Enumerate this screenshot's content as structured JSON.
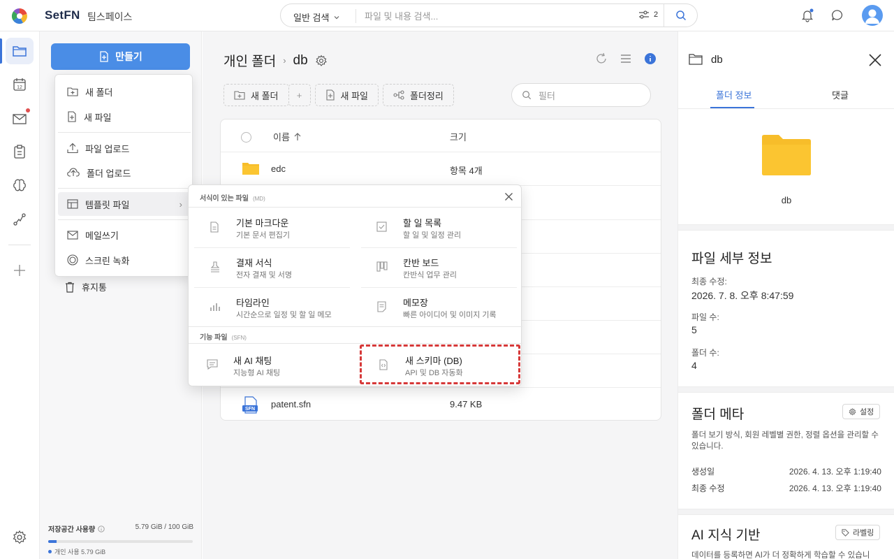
{
  "app": {
    "brand": "SetFN",
    "workspace": "팀스페이스"
  },
  "search": {
    "mode": "일반 검색",
    "placeholder": "파일 및 내용 검색...",
    "filter_count": "2"
  },
  "sidebar": {
    "create_label": "만들기",
    "trash_label": "휴지통",
    "storage_label": "저장공간 사용량",
    "storage_value": "5.79 GiB / 100 GiB",
    "storage_used_fraction": 0.058,
    "storage_personal": "개인 사용 5.79 GiB"
  },
  "create_menu": {
    "items": [
      {
        "label": "새 폴더",
        "icon": "folder-plus-icon"
      },
      {
        "label": "새 파일",
        "icon": "file-plus-icon"
      },
      {
        "label": "파일 업로드",
        "icon": "upload-icon"
      },
      {
        "label": "폴더 업로드",
        "icon": "cloud-upload-icon"
      },
      {
        "label": "템플릿 파일",
        "icon": "template-icon"
      },
      {
        "label": "메일쓰기",
        "icon": "mail-icon"
      },
      {
        "label": "스크린 녹화",
        "icon": "record-icon"
      }
    ]
  },
  "template_menu": {
    "section1_title": "서식이 있는 파일",
    "section1_tag": "(MD)",
    "section2_title": "기능 파일",
    "section2_tag": "(SFN)",
    "items": [
      {
        "title": "기본 마크다운",
        "desc": "기본 문서 편집기",
        "icon": "document-icon"
      },
      {
        "title": "할 일 목록",
        "desc": "할 일 및 일정 관리",
        "icon": "checkbox-icon"
      },
      {
        "title": "결재 서식",
        "desc": "전자 결재 및 서명",
        "icon": "stamp-icon"
      },
      {
        "title": "칸반 보드",
        "desc": "칸반식 업무 관리",
        "icon": "kanban-icon"
      },
      {
        "title": "타임라인",
        "desc": "시간순으로 일정 및 할 일 메모",
        "icon": "bar-chart-icon"
      },
      {
        "title": "메모장",
        "desc": "빠른 아이디어 및 이미지 기록",
        "icon": "memo-icon"
      },
      {
        "title": "새 AI 채팅",
        "desc": "지능형 AI 채팅",
        "icon": "chat-icon"
      },
      {
        "title": "새 스키마 (DB)",
        "desc": "API 및 DB 자동화",
        "icon": "code-file-icon"
      }
    ]
  },
  "main": {
    "breadcrumb_parent": "개인 폴더",
    "breadcrumb_current": "db",
    "toolbar": {
      "new_folder": "새 폴더",
      "plus": "+",
      "new_file": "새 파일",
      "organize": "폴더정리",
      "filter_placeholder": "필터"
    },
    "table": {
      "col_name": "이름",
      "col_size": "크기",
      "rows": [
        {
          "name": "edc",
          "size": "항목 4개",
          "type": "folder"
        },
        {
          "name": "patent.sfn",
          "size": "9.47 KB",
          "type": "sfn"
        }
      ]
    }
  },
  "details": {
    "folder_name": "db",
    "tab_info": "폴더 정보",
    "tab_comments": "댓글",
    "section_file_details": "파일 세부 정보",
    "last_modified_label": "최종 수정:",
    "last_modified_value": "2026. 7. 8. 오후 8:47:59",
    "file_count_label": "파일 수:",
    "file_count_value": "5",
    "folder_count_label": "폴더 수:",
    "folder_count_value": "4",
    "section_meta": "폴더 메타",
    "settings_button": "설정",
    "meta_desc": "폴더 보기 방식, 회원 레벨별 권한, 정렬 옵션을 관리할 수 있습니다.",
    "created_label": "생성일",
    "created_value": "2026. 4. 13. 오후 1:19:40",
    "modified_label": "최종 수정",
    "modified_value": "2026. 4. 13. 오후 1:19:40",
    "section_ai": "AI 지식 기반",
    "label_button": "라벨링",
    "ai_desc": "데이터를 등록하면 AI가 더 정확하게 학습할 수 있습니"
  },
  "colors": {
    "accent": "#3b74d9",
    "create_button": "#4a8de6",
    "folder": "#f7bd2a",
    "highlight": "#d63939"
  }
}
